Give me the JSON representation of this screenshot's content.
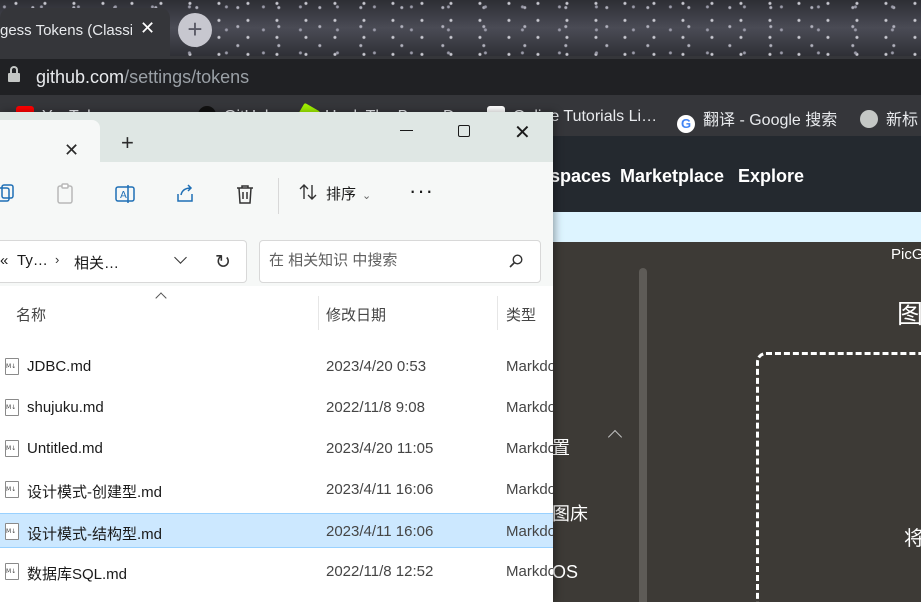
{
  "browser": {
    "active_tab_title": "gess Tokens (Classi",
    "url_host": "github.com",
    "url_path": "/settings/tokens",
    "bookmarks": [
      {
        "label": "YouTube",
        "icon": "youtube-icon",
        "color": "#ff0000"
      },
      {
        "label": "GitHub",
        "icon": "github-icon",
        "color": "#111111"
      },
      {
        "label": "Hack The Box :: D…",
        "icon": "hackthebox-icon",
        "color": "#9fef00"
      },
      {
        "label": "Online Tutorials Li…",
        "icon": "tutorialspoint-icon",
        "color": "#ffffff"
      },
      {
        "label": "翻译 - Google 搜索",
        "icon": "google-icon",
        "color": "#4285f4"
      },
      {
        "label": "新标",
        "icon": "globe-icon",
        "color": "#c4c7c5"
      }
    ]
  },
  "github": {
    "nav": [
      "spaces",
      "Marketplace",
      "Explore"
    ],
    "picg_label": "PicG",
    "heading_fragment": "图",
    "side_fragments": [
      "置",
      "图床",
      "OS"
    ],
    "body_fragment": "将"
  },
  "explorer": {
    "toolbar": {
      "sort_label": "排序",
      "more_label": "···"
    },
    "breadcrumb": {
      "overflow": "«",
      "parent": "Ty…",
      "current": "相关…"
    },
    "search": {
      "placeholder": "在 相关知识 中搜索"
    },
    "columns": {
      "name": "名称",
      "date": "修改日期",
      "type": "类型"
    },
    "files": [
      {
        "name": "JDBC.md",
        "date": "2023/4/20 0:53",
        "type": "Markdown",
        "selected": false
      },
      {
        "name": "shujuku.md",
        "date": "2022/11/8 9:08",
        "type": "Markdown",
        "selected": false
      },
      {
        "name": "Untitled.md",
        "date": "2023/4/20 11:05",
        "type": "Markdown",
        "selected": false
      },
      {
        "name": "设计模式-创建型.md",
        "date": "2023/4/11 16:06",
        "type": "Markdown",
        "selected": false
      },
      {
        "name": "设计模式-结构型.md",
        "date": "2023/4/11 16:06",
        "type": "Markdown",
        "selected": true
      },
      {
        "name": "数据库SQL.md",
        "date": "2022/11/8 12:52",
        "type": "Markdown",
        "selected": false
      }
    ],
    "colors": {
      "selected_row": "#cce8ff",
      "titlebar": "#dfe7e4"
    }
  }
}
